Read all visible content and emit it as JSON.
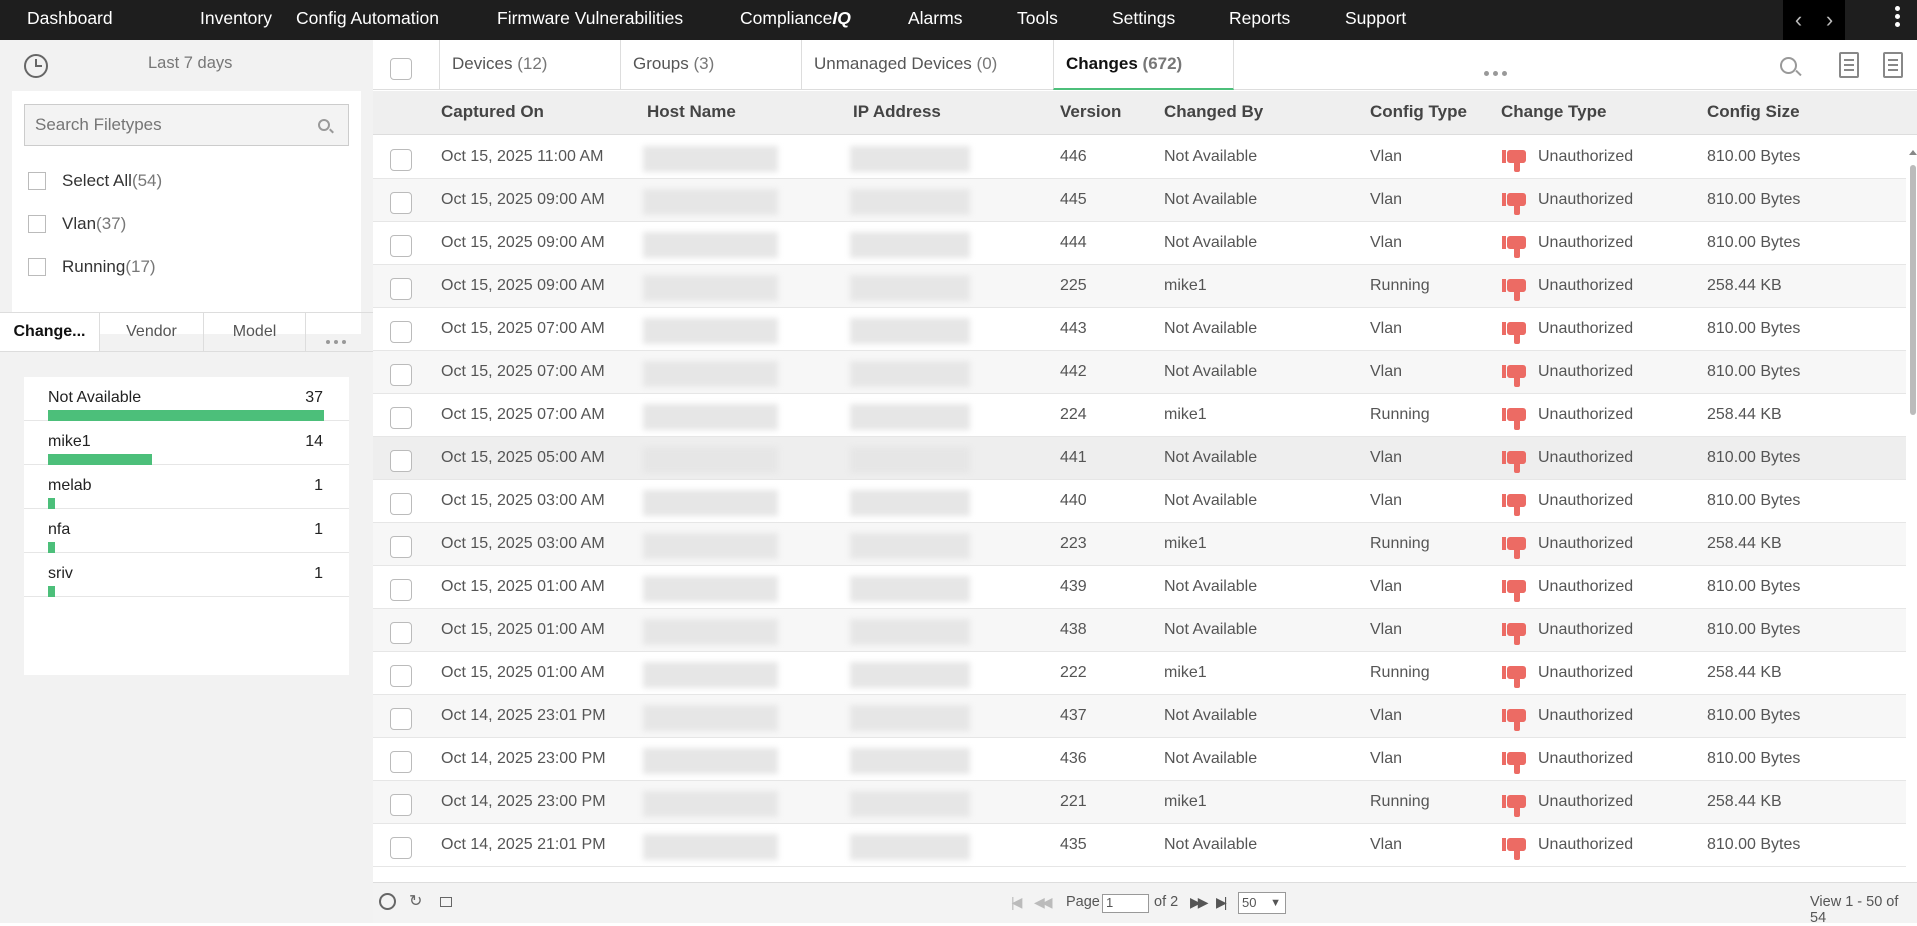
{
  "nav": {
    "items": [
      "Dashboard",
      "Inventory",
      "Config Automation",
      "Firmware Vulnerabilities",
      "Compliance",
      "Alarms",
      "Tools",
      "Settings",
      "Reports",
      "Support"
    ],
    "compliance_suffix": "IQ"
  },
  "left": {
    "time_label": "Last 7 days",
    "search_placeholder": "Search Filetypes",
    "filetypes": [
      {
        "label": "Select All",
        "count": "(54)"
      },
      {
        "label": "Vlan",
        "count": "(37)"
      },
      {
        "label": "Running",
        "count": "(17)"
      }
    ],
    "tabs": [
      "Change...",
      "Vendor",
      "Model"
    ],
    "bars": [
      {
        "label": "Not Available",
        "value": "37",
        "fraction": 1.0
      },
      {
        "label": "mike1",
        "value": "14",
        "fraction": 0.378
      },
      {
        "label": "melab",
        "value": "1",
        "fraction": 0.027
      },
      {
        "label": "nfa",
        "value": "1",
        "fraction": 0.027
      },
      {
        "label": "sriv",
        "value": "1",
        "fraction": 0.027
      }
    ]
  },
  "tabs": [
    {
      "label": "Devices",
      "count": "(12)"
    },
    {
      "label": "Groups",
      "count": "(3)"
    },
    {
      "label": "Unmanaged Devices",
      "count": "(0)"
    },
    {
      "label": "Changes",
      "count": "(672)"
    }
  ],
  "columns": [
    "Captured On",
    "Host Name",
    "IP Address",
    "Version",
    "Changed By",
    "Config Type",
    "Change Type",
    "Config Size"
  ],
  "rows": [
    {
      "captured": "Oct 15, 2025 11:00 AM",
      "version": "446",
      "by": "Not Available",
      "type": "Vlan",
      "change": "Unauthorized",
      "size": "810.00 Bytes"
    },
    {
      "captured": "Oct 15, 2025 09:00 AM",
      "version": "445",
      "by": "Not Available",
      "type": "Vlan",
      "change": "Unauthorized",
      "size": "810.00 Bytes"
    },
    {
      "captured": "Oct 15, 2025 09:00 AM",
      "version": "444",
      "by": "Not Available",
      "type": "Vlan",
      "change": "Unauthorized",
      "size": "810.00 Bytes"
    },
    {
      "captured": "Oct 15, 2025 09:00 AM",
      "version": "225",
      "by": "mike1",
      "type": "Running",
      "change": "Unauthorized",
      "size": "258.44 KB"
    },
    {
      "captured": "Oct 15, 2025 07:00 AM",
      "version": "443",
      "by": "Not Available",
      "type": "Vlan",
      "change": "Unauthorized",
      "size": "810.00 Bytes"
    },
    {
      "captured": "Oct 15, 2025 07:00 AM",
      "version": "442",
      "by": "Not Available",
      "type": "Vlan",
      "change": "Unauthorized",
      "size": "810.00 Bytes"
    },
    {
      "captured": "Oct 15, 2025 07:00 AM",
      "version": "224",
      "by": "mike1",
      "type": "Running",
      "change": "Unauthorized",
      "size": "258.44 KB"
    },
    {
      "captured": "Oct 15, 2025 05:00 AM",
      "version": "441",
      "by": "Not Available",
      "type": "Vlan",
      "change": "Unauthorized",
      "size": "810.00 Bytes"
    },
    {
      "captured": "Oct 15, 2025 03:00 AM",
      "version": "440",
      "by": "Not Available",
      "type": "Vlan",
      "change": "Unauthorized",
      "size": "810.00 Bytes"
    },
    {
      "captured": "Oct 15, 2025 03:00 AM",
      "version": "223",
      "by": "mike1",
      "type": "Running",
      "change": "Unauthorized",
      "size": "258.44 KB"
    },
    {
      "captured": "Oct 15, 2025 01:00 AM",
      "version": "439",
      "by": "Not Available",
      "type": "Vlan",
      "change": "Unauthorized",
      "size": "810.00 Bytes"
    },
    {
      "captured": "Oct 15, 2025 01:00 AM",
      "version": "438",
      "by": "Not Available",
      "type": "Vlan",
      "change": "Unauthorized",
      "size": "810.00 Bytes"
    },
    {
      "captured": "Oct 15, 2025 01:00 AM",
      "version": "222",
      "by": "mike1",
      "type": "Running",
      "change": "Unauthorized",
      "size": "258.44 KB"
    },
    {
      "captured": "Oct 14, 2025 23:01 PM",
      "version": "437",
      "by": "Not Available",
      "type": "Vlan",
      "change": "Unauthorized",
      "size": "810.00 Bytes"
    },
    {
      "captured": "Oct 14, 2025 23:00 PM",
      "version": "436",
      "by": "Not Available",
      "type": "Vlan",
      "change": "Unauthorized",
      "size": "810.00 Bytes"
    },
    {
      "captured": "Oct 14, 2025 23:00 PM",
      "version": "221",
      "by": "mike1",
      "type": "Running",
      "change": "Unauthorized",
      "size": "258.44 KB"
    },
    {
      "captured": "Oct 14, 2025 21:01 PM",
      "version": "435",
      "by": "Not Available",
      "type": "Vlan",
      "change": "Unauthorized",
      "size": "810.00 Bytes"
    }
  ],
  "pager": {
    "page_label": "Page",
    "page_value": "1",
    "of_label": "of 2",
    "per_page": "50",
    "view_text": "View 1 - 50 of 54"
  },
  "colors": {
    "accent": "#4cbf7a",
    "unauthorized": "#ec6b64",
    "topbar": "#1e1e1e"
  }
}
